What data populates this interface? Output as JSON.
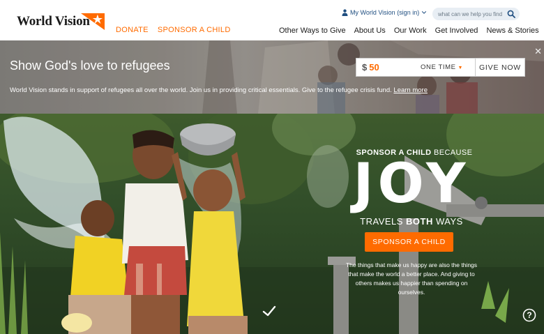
{
  "brand": {
    "name": "World Vision",
    "accent_color": "#ff6b00",
    "navy": "#1f4e80"
  },
  "header": {
    "primary_links": [
      {
        "label": "DONATE"
      },
      {
        "label": "SPONSOR A CHILD"
      }
    ],
    "account_label": "My World Vision (sign in)",
    "search_placeholder": "what can we help you find?",
    "nav": [
      {
        "label": "Other Ways to Give"
      },
      {
        "label": "About Us"
      },
      {
        "label": "Our Work"
      },
      {
        "label": "Get Involved"
      },
      {
        "label": "News & Stories"
      }
    ]
  },
  "banner": {
    "title": "Show God's love to refugees",
    "text": "World Vision stands in support of refugees all over the world. Join us in providing critical essentials. Give to the refugee crisis fund.",
    "link": "Learn more",
    "currency": "$",
    "amount": "50",
    "frequency": "ONE TIME",
    "give_label": "GIVE NOW"
  },
  "hero": {
    "tagline_strong": "SPONSOR A CHILD",
    "tagline_rest": "BECAUSE",
    "headline": "JOY",
    "sub_pre": "TRAVELS ",
    "sub_strong": "BOTH",
    "sub_post": " WAYS",
    "cta_label": "SPONSOR A CHILD",
    "description": "The things that make us happy are also the things that make the world a better place. And giving to others makes us happier than spending on ourselves."
  }
}
